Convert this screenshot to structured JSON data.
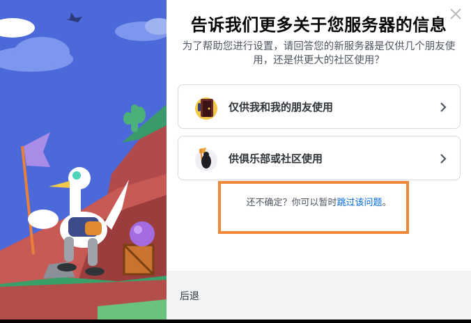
{
  "dialog": {
    "title": "告诉我们更多关于您服务器的信息",
    "subtitle": "为了帮助您进行设置，请回答您的新服务器是仅供几个朋友使用，还是供更大的社区使用？",
    "options": [
      {
        "label": "仅供我和我的朋友使用",
        "icon": "friends-door-icon"
      },
      {
        "label": "供俱乐部或社区使用",
        "icon": "community-flag-icon"
      }
    ],
    "hint": {
      "prefix": "还不确定？你可以暂时",
      "link": "跳过该问题",
      "suffix": "。"
    },
    "back_label": "后退"
  },
  "colors": {
    "link": "#0068e0",
    "highlight": "#f0883a",
    "sky": "#4c6bdc",
    "footer": "#f2f3f5"
  }
}
